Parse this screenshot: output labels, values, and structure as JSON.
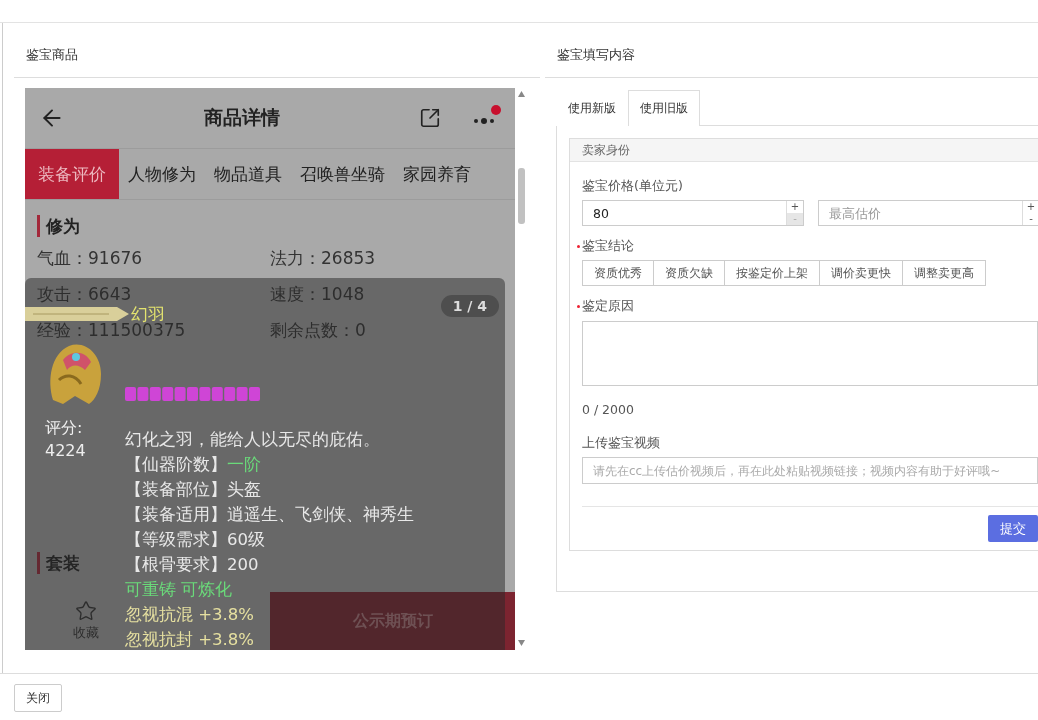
{
  "left_title": "鉴宝商品",
  "right_title": "鉴宝填写内容",
  "product_page": {
    "title": "商品详情",
    "has_notification": true,
    "tabs": [
      {
        "label": "装备评价",
        "selected": true
      },
      {
        "label": "人物修为",
        "selected": false
      },
      {
        "label": "物品道具",
        "selected": false
      },
      {
        "label": "召唤兽坐骑",
        "selected": false
      },
      {
        "label": "家园养育",
        "selected": false
      }
    ],
    "heading": "修为",
    "stats": [
      [
        "气血：91676",
        "法力：26853"
      ],
      [
        "攻击：6643",
        "速度：1048"
      ],
      [
        "经验：111500375",
        "剩余点数：0"
      ]
    ],
    "second_heading": "套装",
    "favorite_label": "收藏",
    "action_button": "公示期预订",
    "tooltip": {
      "name": "幻羽",
      "pager": "1 / 4",
      "score_label": "评分:",
      "score": "4224",
      "lines": [
        {
          "kind": "text",
          "text": "幻化之羽，能给人以无尽的庇佑。",
          "color": "#e8e8e8"
        },
        {
          "kind": "attribute",
          "label": "【仙器阶数】",
          "value": "一阶",
          "color": "#6ada7a"
        },
        {
          "kind": "attribute",
          "label": "【装备部位】",
          "value": "头盔",
          "color": "#e8e8e8"
        },
        {
          "kind": "attribute",
          "label": "【装备适用】",
          "value": "逍遥生、飞剑侠、神秀生",
          "color": "#e8e8e8"
        },
        {
          "kind": "attribute",
          "label": "【等级需求】",
          "value": "60级",
          "color": "#e8e8e8"
        },
        {
          "kind": "attribute",
          "label": "【根骨要求】",
          "value": "200",
          "color": "#e8e8e8"
        },
        {
          "kind": "text",
          "text": "可重铸 可炼化",
          "color": "#6ada7a"
        },
        {
          "kind": "text",
          "text": "忽视抗混 +3.8%",
          "color": "#e6e0a0"
        },
        {
          "kind": "text",
          "text": "忽视抗封 +3.8%",
          "color": "#e6e0a0"
        }
      ]
    }
  },
  "form": {
    "tabs": [
      {
        "label": "使用新版",
        "selected": false
      },
      {
        "label": "使用旧版",
        "selected": true
      }
    ],
    "panel_title": "卖家身份",
    "price_label": "鉴宝价格(单位元)",
    "price_inputs": [
      {
        "value": "80",
        "increment": "+",
        "decrement": "-",
        "decrement_disabled": true
      },
      {
        "placeholder": "最高估价",
        "increment": "+",
        "decrement": "-",
        "decrement_disabled": false
      }
    ],
    "conclusion": {
      "label": "鉴宝结论",
      "required": true,
      "options": [
        {
          "label": "资质优秀",
          "selected": false
        },
        {
          "label": "资质欠缺",
          "selected": false
        },
        {
          "label": "按鉴定价上架",
          "selected": false
        },
        {
          "label": "调价卖更快",
          "selected": false
        },
        {
          "label": "调整卖更高",
          "selected": false
        }
      ]
    },
    "reason": {
      "label": "鉴定原因",
      "required": true,
      "counter": "0 / 2000"
    },
    "video": {
      "label": "上传鉴宝视频",
      "placeholder": "请先在cc上传估价视频后，再在此处粘贴视频链接；视频内容有助于好评哦~"
    },
    "submit": "提交"
  },
  "close_button": "关闭"
}
